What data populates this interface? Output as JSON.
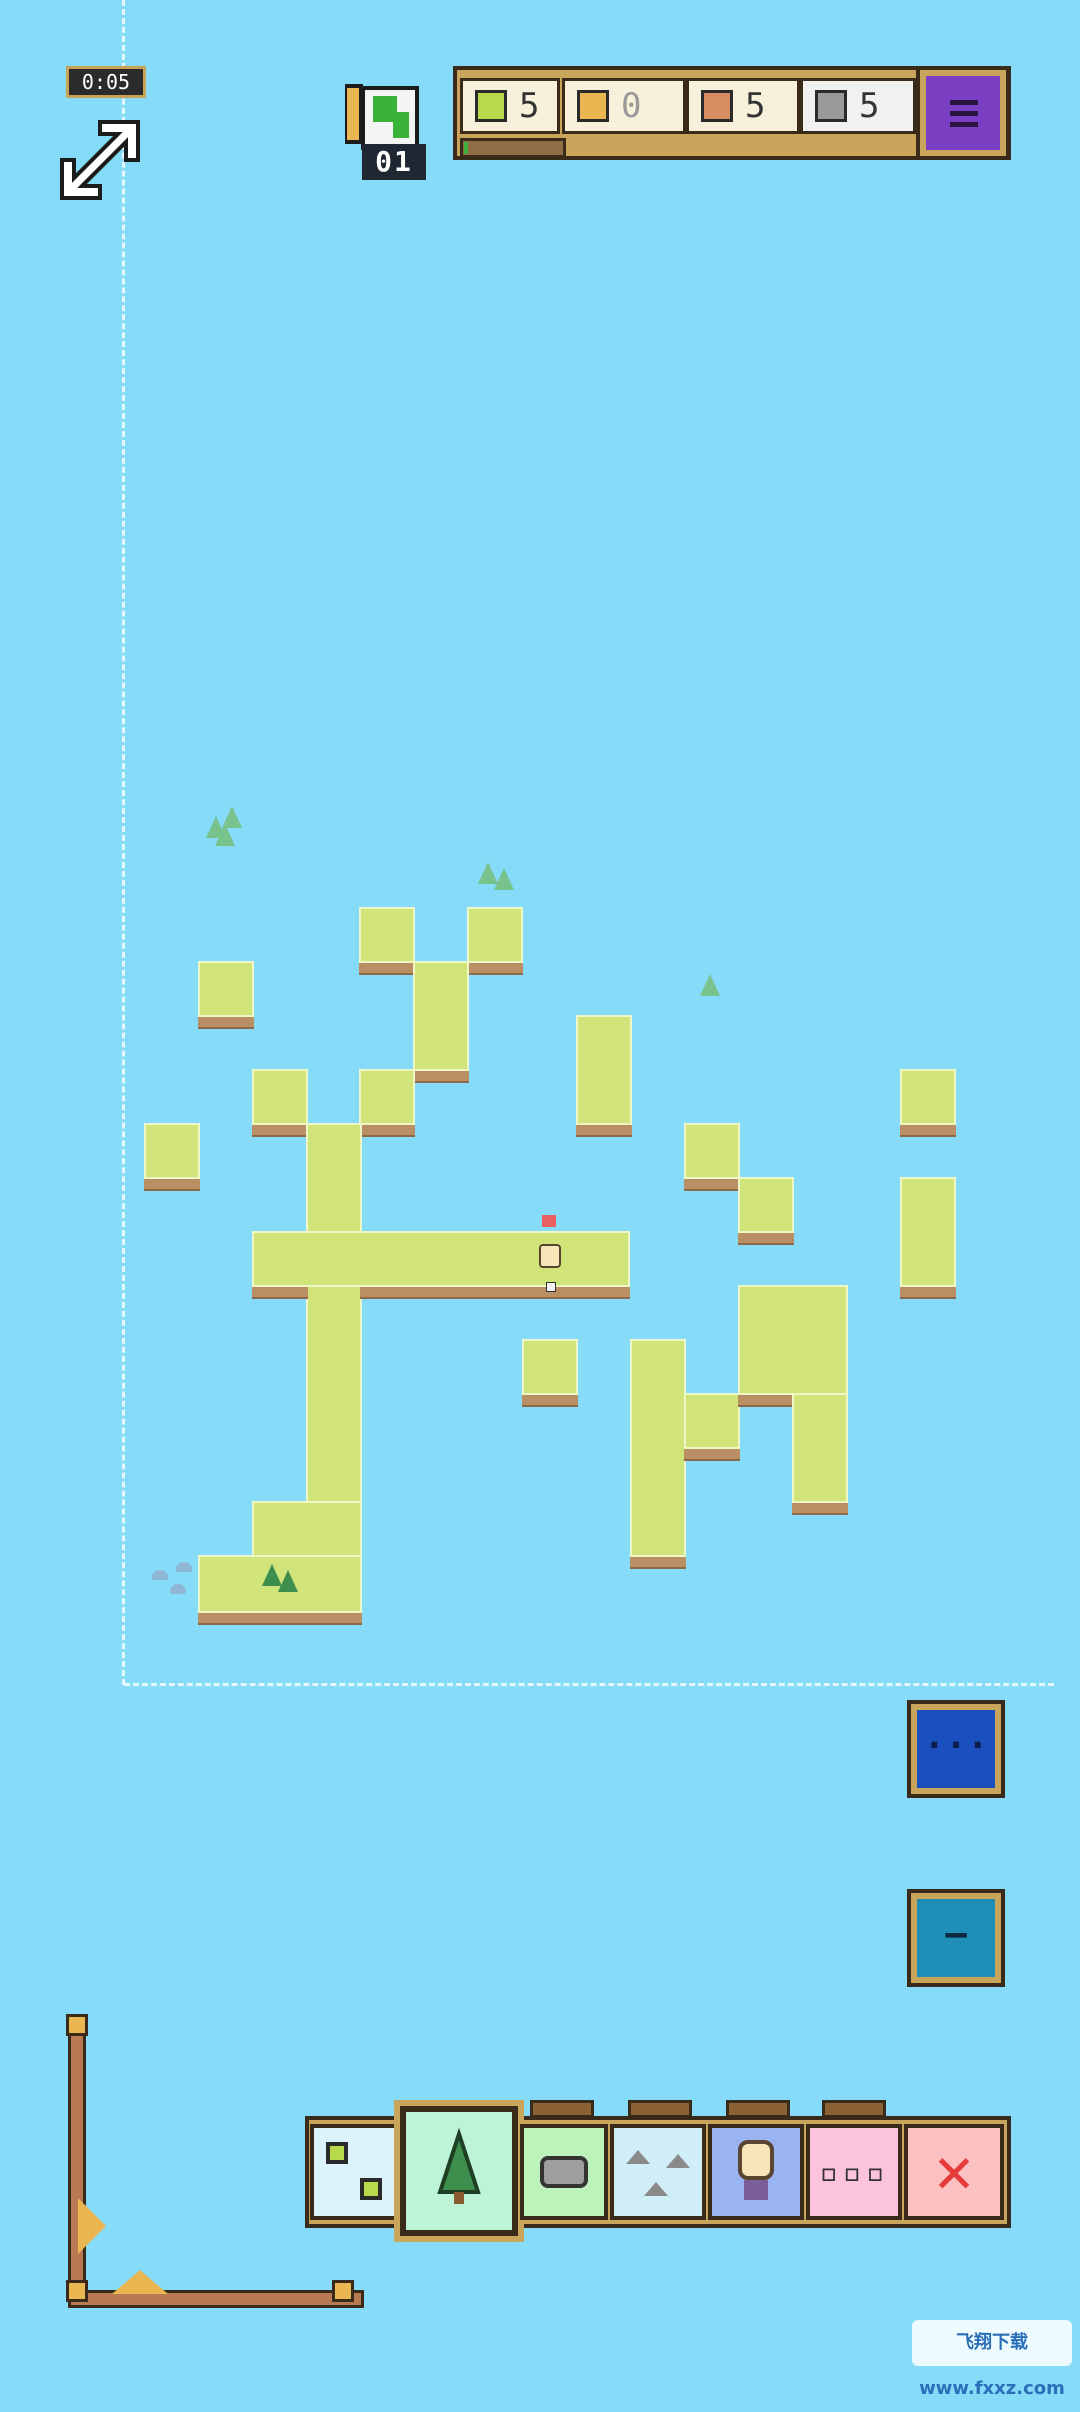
{
  "timer": "0:05",
  "level": "01",
  "resources": [
    {
      "name": "leaf",
      "value": "5",
      "icon": "leaf-tile-icon",
      "bg": "#F7F1DC",
      "icon_color": "#B8D94A"
    },
    {
      "name": "wood",
      "value": "0",
      "icon": "wood-crate-icon",
      "bg": "#F7F1DC",
      "icon_color": "#E9B652"
    },
    {
      "name": "clay",
      "value": "5",
      "icon": "clay-block-icon",
      "bg": "#F7F1DC",
      "icon_color": "#D68D62"
    },
    {
      "name": "stone",
      "value": "5",
      "icon": "stone-block-icon",
      "bg": "#F1F1F1",
      "icon_color": "#9A9A9A"
    }
  ],
  "expansion_progress": 0.03,
  "menu_icon": "hamburger-menu-icon",
  "toolbar": {
    "selected": "tree",
    "tools": [
      "land-tiles",
      "tree",
      "rock",
      "mountains",
      "villager",
      "more",
      "delete"
    ],
    "more_label": "▫▫▫",
    "delete_label": "✕"
  },
  "buttons": {
    "more_label": "···",
    "zoom_out_label": "−"
  },
  "watermark": "飞翔下载 www.fxxz.com"
}
